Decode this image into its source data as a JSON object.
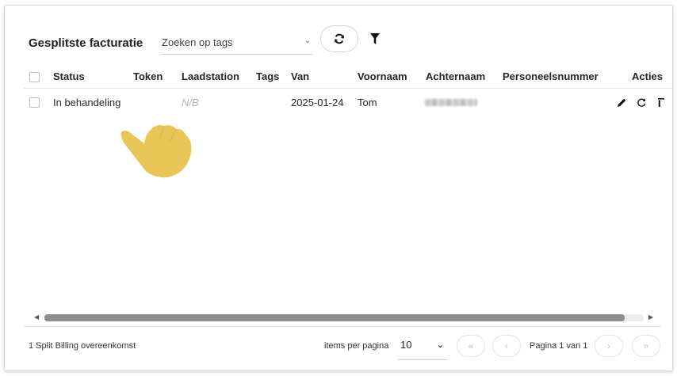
{
  "header": {
    "title": "Gesplitste facturatie",
    "tag_search_placeholder": "Zoeken op tags"
  },
  "table": {
    "columns": [
      "Status",
      "Token",
      "Laadstation",
      "Tags",
      "Van",
      "Voornaam",
      "Achternaam",
      "Personeelsnummer",
      "Acties"
    ],
    "rows": [
      {
        "status": "In behandeling",
        "token": "",
        "laadstation": "N/B",
        "tags": "",
        "van": "2025-01-24",
        "voornaam": "Tom",
        "achternaam": "",
        "personeelsnummer": ""
      }
    ]
  },
  "footer": {
    "record_count": "1 Split Billing overeenkomst",
    "items_per_page_label": "items per pagina",
    "items_per_page_value": "10",
    "page_info": "Pagina 1 van 1",
    "first_symbol": "«",
    "prev_symbol": "‹",
    "next_symbol": "›",
    "last_symbol": "»"
  },
  "icons": {
    "refresh": "refresh-icon",
    "filter": "filter-icon",
    "edit": "pencil-icon",
    "row_refresh": "refresh-icon",
    "delete": "trash-icon",
    "pointer": "hand-pointer-icon"
  },
  "colors": {
    "hand": "#e8c24e",
    "scroll_thumb": "#8d8d8d"
  }
}
